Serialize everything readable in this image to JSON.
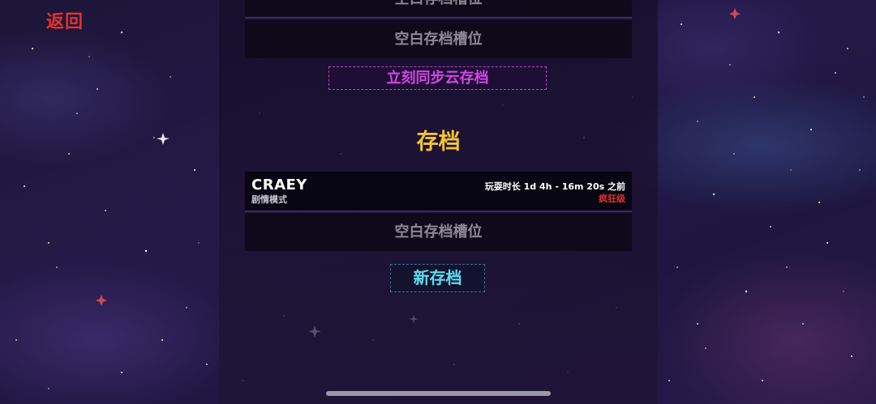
{
  "header": {
    "back_label": "返回"
  },
  "cloud_section": {
    "partial_slot_label": "空白存档槽位",
    "empty_slot_label": "空白存档槽位",
    "sync_button_label": "立刻同步云存档"
  },
  "local_section": {
    "title": "存档",
    "saves": [
      {
        "name": "CRAEY",
        "mode": "剧情模式",
        "playtime": "玩耍时长 1d 4h - 16m 20s 之前",
        "difficulty": "疯狂级"
      }
    ],
    "empty_slot_label": "空白存档槽位",
    "new_save_label": "新存档"
  },
  "colors": {
    "back": "#e8312c",
    "sync_accent": "#d246e6",
    "title": "#f2c531",
    "new_save_accent": "#5fdcf0",
    "difficulty": "#e0332c",
    "empty_slot_text": "#8d8a96"
  }
}
